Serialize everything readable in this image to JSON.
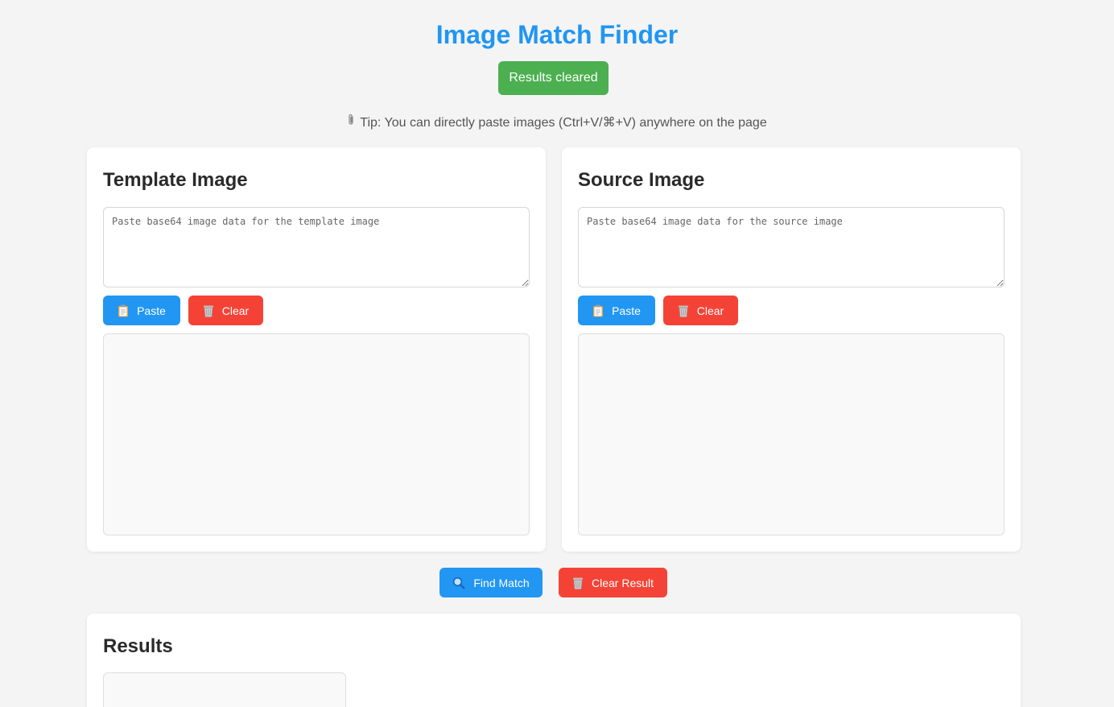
{
  "app": {
    "title": "Image Match Finder",
    "toast": "Results cleared",
    "tip": "Tip: You can directly paste images (Ctrl+V/⌘+V) anywhere on the page",
    "tip_icon": "paperclip-icon"
  },
  "template": {
    "heading": "Template Image",
    "placeholder": "Paste base64 image data for the template image",
    "paste_label": "Paste",
    "clear_label": "Clear"
  },
  "source": {
    "heading": "Source Image",
    "placeholder": "Paste base64 image data for the source image",
    "paste_label": "Paste",
    "clear_label": "Clear"
  },
  "actions": {
    "find_label": "Find Match",
    "clear_result_label": "Clear Result"
  },
  "results": {
    "heading": "Results"
  },
  "colors": {
    "accent": "#2196f3",
    "success": "#4caf50",
    "danger": "#f44336",
    "background": "#f4f4f4"
  }
}
